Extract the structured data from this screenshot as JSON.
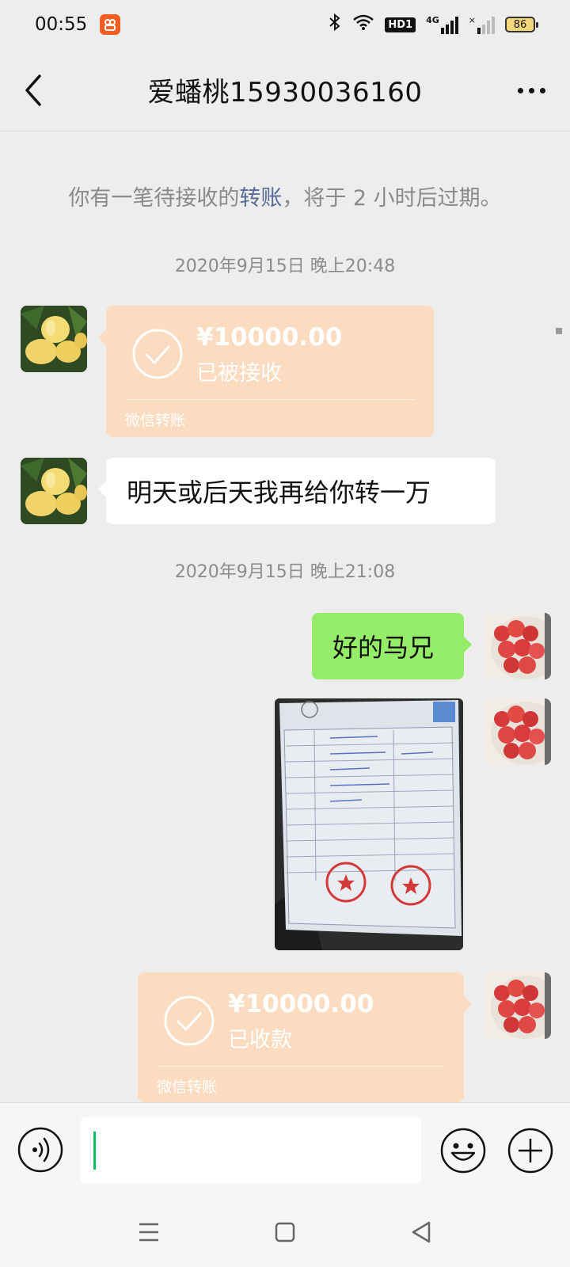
{
  "status_bar": {
    "time": "00:55",
    "hd_label": "HD1",
    "network_label": "4G",
    "battery_level": "86"
  },
  "header": {
    "title": "爱蟠桃15930036160"
  },
  "system_notice": {
    "prefix": "你有一笔待接收的",
    "link": "转账",
    "suffix": "，将于 2 小时后过期。"
  },
  "messages": {
    "timestamp_1": "2020年9月15日 晚上20:48",
    "transfer_1": {
      "amount": "¥10000.00",
      "status": "已被接收",
      "footer": "微信转账"
    },
    "text_1": "明天或后天我再给你转一万",
    "timestamp_2": "2020年9月15日 晚上21:08",
    "text_2": "好的马兄",
    "transfer_2": {
      "amount": "¥10000.00",
      "status": "已收款",
      "footer": "微信转账"
    }
  },
  "icons": {
    "back": "chevron-left-icon",
    "more": "more-dots-icon",
    "voice": "voice-icon",
    "emoji": "emoji-icon",
    "plus": "plus-icon"
  },
  "colors": {
    "sent_bubble": "#95ec69",
    "transfer_bubble": "#fbdcc0",
    "link": "#576b95",
    "caret": "#07c160"
  }
}
